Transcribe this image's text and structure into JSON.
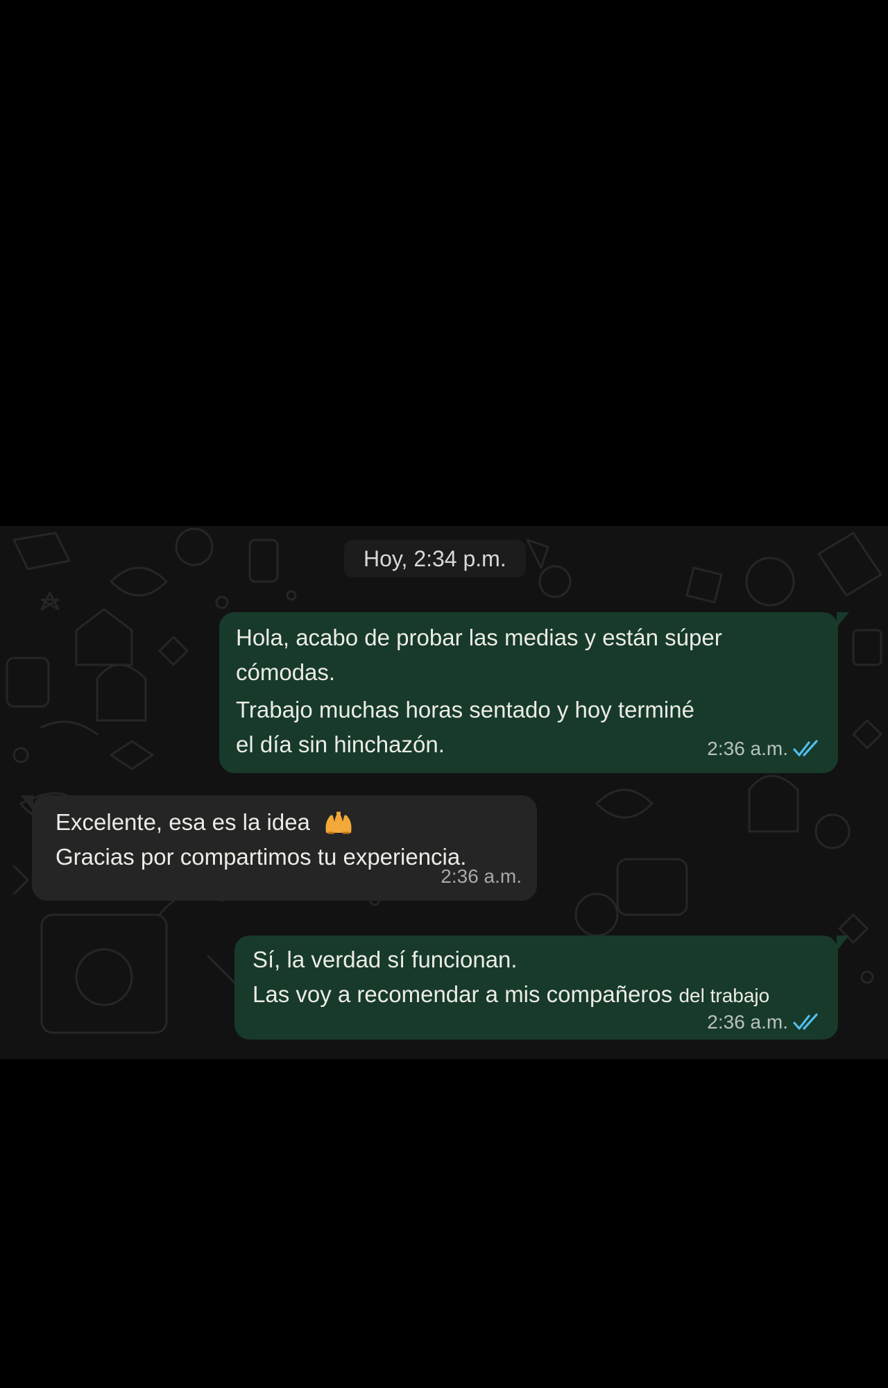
{
  "chat": {
    "date_chip": "Hoy, 2:34 p.m.",
    "colors": {
      "outgoing_bubble": "#173a2b",
      "incoming_bubble": "#252525",
      "background": "#121212",
      "read_ticks": "#53bdeb"
    },
    "messages": [
      {
        "direction": "outgoing",
        "lines": [
          "Hola, acabo de probar las medias y están súper",
          "cómodas.",
          "Trabajo muchas horas sentado y hoy terminé",
          "el día sin hinchazón."
        ],
        "time": "2:36 a.m.",
        "status_icon": "double-check-read-icon"
      },
      {
        "direction": "incoming",
        "lines": [
          "Excelente, esa es la idea",
          "Gracias por compartimos tu experiencia."
        ],
        "emoji_icon": "raising-hands-icon",
        "time": "2:36 a.m."
      },
      {
        "direction": "outgoing",
        "lines": [
          "Sí, la verdad sí funcionan.",
          "Las voy a recomendar a mis compañeros",
          "del trabajo"
        ],
        "time": "2:36 a.m.",
        "status_icon": "double-check-read-icon"
      }
    ]
  }
}
